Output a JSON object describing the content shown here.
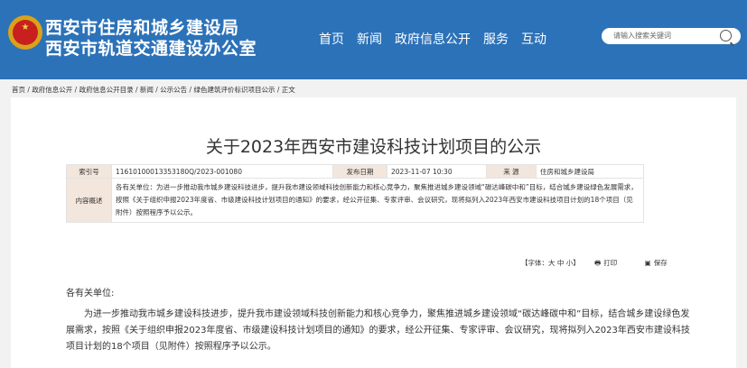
{
  "header": {
    "org_line1": "西安市住房和城乡建设局",
    "org_line2": "西安市轨道交通建设办公室",
    "nav": [
      "首页",
      "新闻",
      "政府信息公开",
      "服务",
      "互动"
    ],
    "search_placeholder": "请输入搜索关键词"
  },
  "breadcrumb": "首页 /  政府信息公开  /  政府信息公开目录  /  新闻  /  公示公告  /  绿色建筑评价标识项目公示  /  正文",
  "article": {
    "title": "关于2023年西安市建设科技计划项目的公示",
    "meta": {
      "index_label": "索引号",
      "index_value": "11610100013353180Q/2023-001080",
      "date_label": "发布日期",
      "date_value": "2023-11-07 10:30",
      "source_label": "来     源",
      "source_value": "住房和城乡建设局",
      "summary_label": "内容概述",
      "summary_value": "各有关单位：为进一步推动我市城乡建设科技进步，提升我市建设领域科技创新能力和核心竞争力，聚焦推进城乡建设领域“碳达峰碳中和”目标，结合城乡建设绿色发展需求，按照《关于组织申报2023年度省、市级建设科技计划项目的通知》的要求，经公开征集、专家评审、会议研究，现将拟列入2023年西安市建设科技项目计划的18个项目（见附件）按照程序予以公示。"
    },
    "tools": {
      "font_size": "【字体：大 中 小】",
      "print": "打印",
      "save": "保存"
    },
    "salutation": "各有关单位:",
    "paragraph": "为进一步推动我市城乡建设科技进步，提升我市建设领域科技创新能力和核心竞争力，聚焦推进城乡建设领域“碳达峰碳中和”目标，结合城乡建设绿色发展需求，按照《关于组织申报2023年度省、市级建设科技计划项目的通知》的要求，经公开征集、专家评审、会议研究，现将拟列入2023年西安市建设科技项目计划的18个项目（见附件）按照程序予以公示。"
  },
  "colors": {
    "header_bg": "#2c72b8",
    "label_bg": "#f3e6dc"
  }
}
